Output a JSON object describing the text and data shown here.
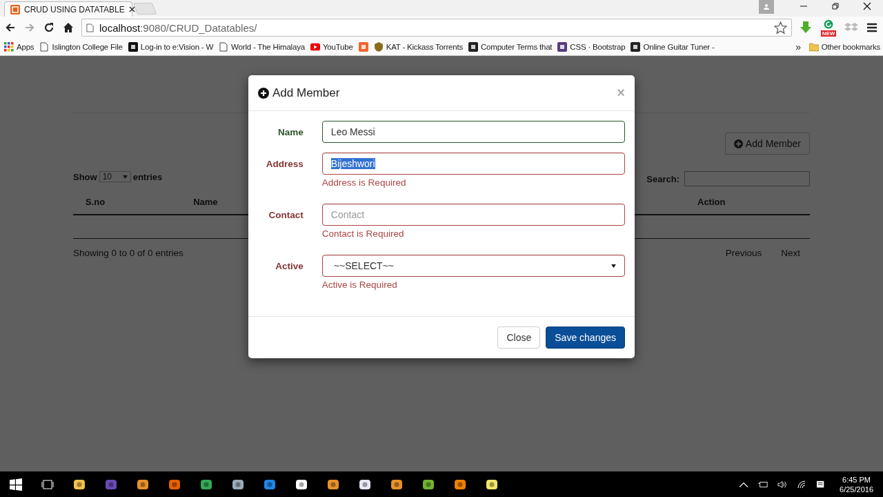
{
  "browser": {
    "tab": {
      "title": "CRUD USING DATATABLE"
    },
    "address": {
      "host": "localhost",
      "path": ":9080/CRUD_Datatables/"
    },
    "bookmarks": [
      {
        "kind": "link",
        "label": "Apps"
      },
      {
        "kind": "link",
        "label": "Islington College File"
      },
      {
        "kind": "link",
        "label": "Log-in to e:Vision - W"
      },
      {
        "kind": "link",
        "label": "World - The Himalaya"
      },
      {
        "kind": "link",
        "label": "YouTube"
      },
      {
        "kind": "icon"
      },
      {
        "kind": "link",
        "label": "KAT - Kickass Torrents"
      },
      {
        "kind": "link",
        "label": "Computer Terms that"
      },
      {
        "kind": "link",
        "label": "CSS · Bootstrap"
      },
      {
        "kind": "link",
        "label": "Online Guitar Tuner -"
      }
    ],
    "more": "»",
    "other_bookmarks": "Other bookmarks",
    "badge": "NEW"
  },
  "page": {
    "add_button": "Add Member",
    "length": {
      "before": "Show",
      "value": "10",
      "after": "entries"
    },
    "search_label": "Search:",
    "columns": [
      {
        "label": "S.no"
      },
      {
        "label": "Name"
      },
      {
        "label": "Action"
      }
    ],
    "info": "Showing 0 to 0 of 0 entries",
    "pagination": [
      "Previous",
      "Next"
    ]
  },
  "modal": {
    "title": "Add Member",
    "close": "×",
    "fields": [
      {
        "kind": "text",
        "label": "Name",
        "value": "Leo Messi",
        "valid": true
      },
      {
        "kind": "text",
        "label": "Address",
        "value": "Bijeshwori",
        "valid": false,
        "highlighted": true,
        "error": "Address is Required"
      },
      {
        "kind": "text",
        "label": "Contact",
        "placeholder": "Contact",
        "valid": false,
        "error": "Contact is Required"
      },
      {
        "kind": "select",
        "label": "Active",
        "value": "~~SELECT~~",
        "valid": false,
        "error": "Active is Required"
      }
    ],
    "buttons": [
      {
        "label": "Close",
        "kind": "default"
      },
      {
        "label": "Save changes",
        "kind": "primary"
      }
    ]
  },
  "taskbar": {
    "time": "6:45 PM",
    "date": "6/25/2016"
  }
}
